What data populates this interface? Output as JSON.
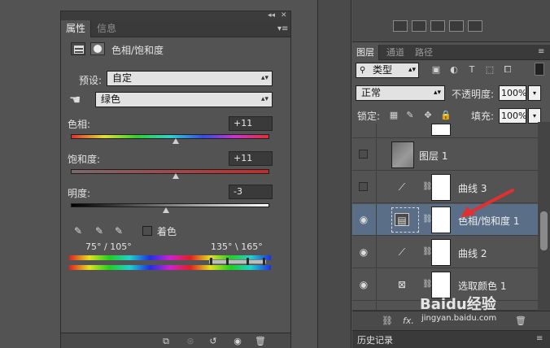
{
  "properties_panel": {
    "tabs": [
      "属性",
      "信息"
    ],
    "title": "色相/饱和度",
    "preset_label": "预设:",
    "preset_value": "自定",
    "channel_value": "绿色",
    "hue": {
      "label": "色相:",
      "value": "+11",
      "level": 0.53
    },
    "saturation": {
      "label": "饱和度:",
      "value": "+11",
      "level": 0.53
    },
    "lightness": {
      "label": "明度:",
      "value": "-3",
      "level": 0.48
    },
    "colorize_label": "着色",
    "range_left": "75° / 105°",
    "range_right": "135° \\ 165°"
  },
  "layers_panel": {
    "tabs": [
      "图层",
      "通道",
      "路径"
    ],
    "filter_type": "类型",
    "blend_mode": "正常",
    "opacity_label": "不透明度:",
    "opacity_value": "100%",
    "lock_label": "锁定:",
    "fill_label": "填充:",
    "fill_value": "100%",
    "layers": [
      {
        "name": "图层 1",
        "kind": "image",
        "visible": false,
        "selected": false
      },
      {
        "name": "曲线 3",
        "kind": "curves",
        "visible": false,
        "selected": false
      },
      {
        "name": "色相/饱和度 1",
        "kind": "hue-saturation",
        "visible": true,
        "selected": true
      },
      {
        "name": "曲线 2",
        "kind": "curves",
        "visible": true,
        "selected": false
      },
      {
        "name": "选取颜色 1",
        "kind": "selective-color",
        "visible": true,
        "selected": false
      }
    ],
    "footer_fx": "fx."
  },
  "history_tab": "历史记录",
  "watermark": {
    "brand": "Baidu经验",
    "url": "jingyan.baidu.com"
  },
  "colors": {
    "panel_bg": "#535353",
    "selected_layer": "#5a6f87",
    "arrow": "#e03030"
  }
}
